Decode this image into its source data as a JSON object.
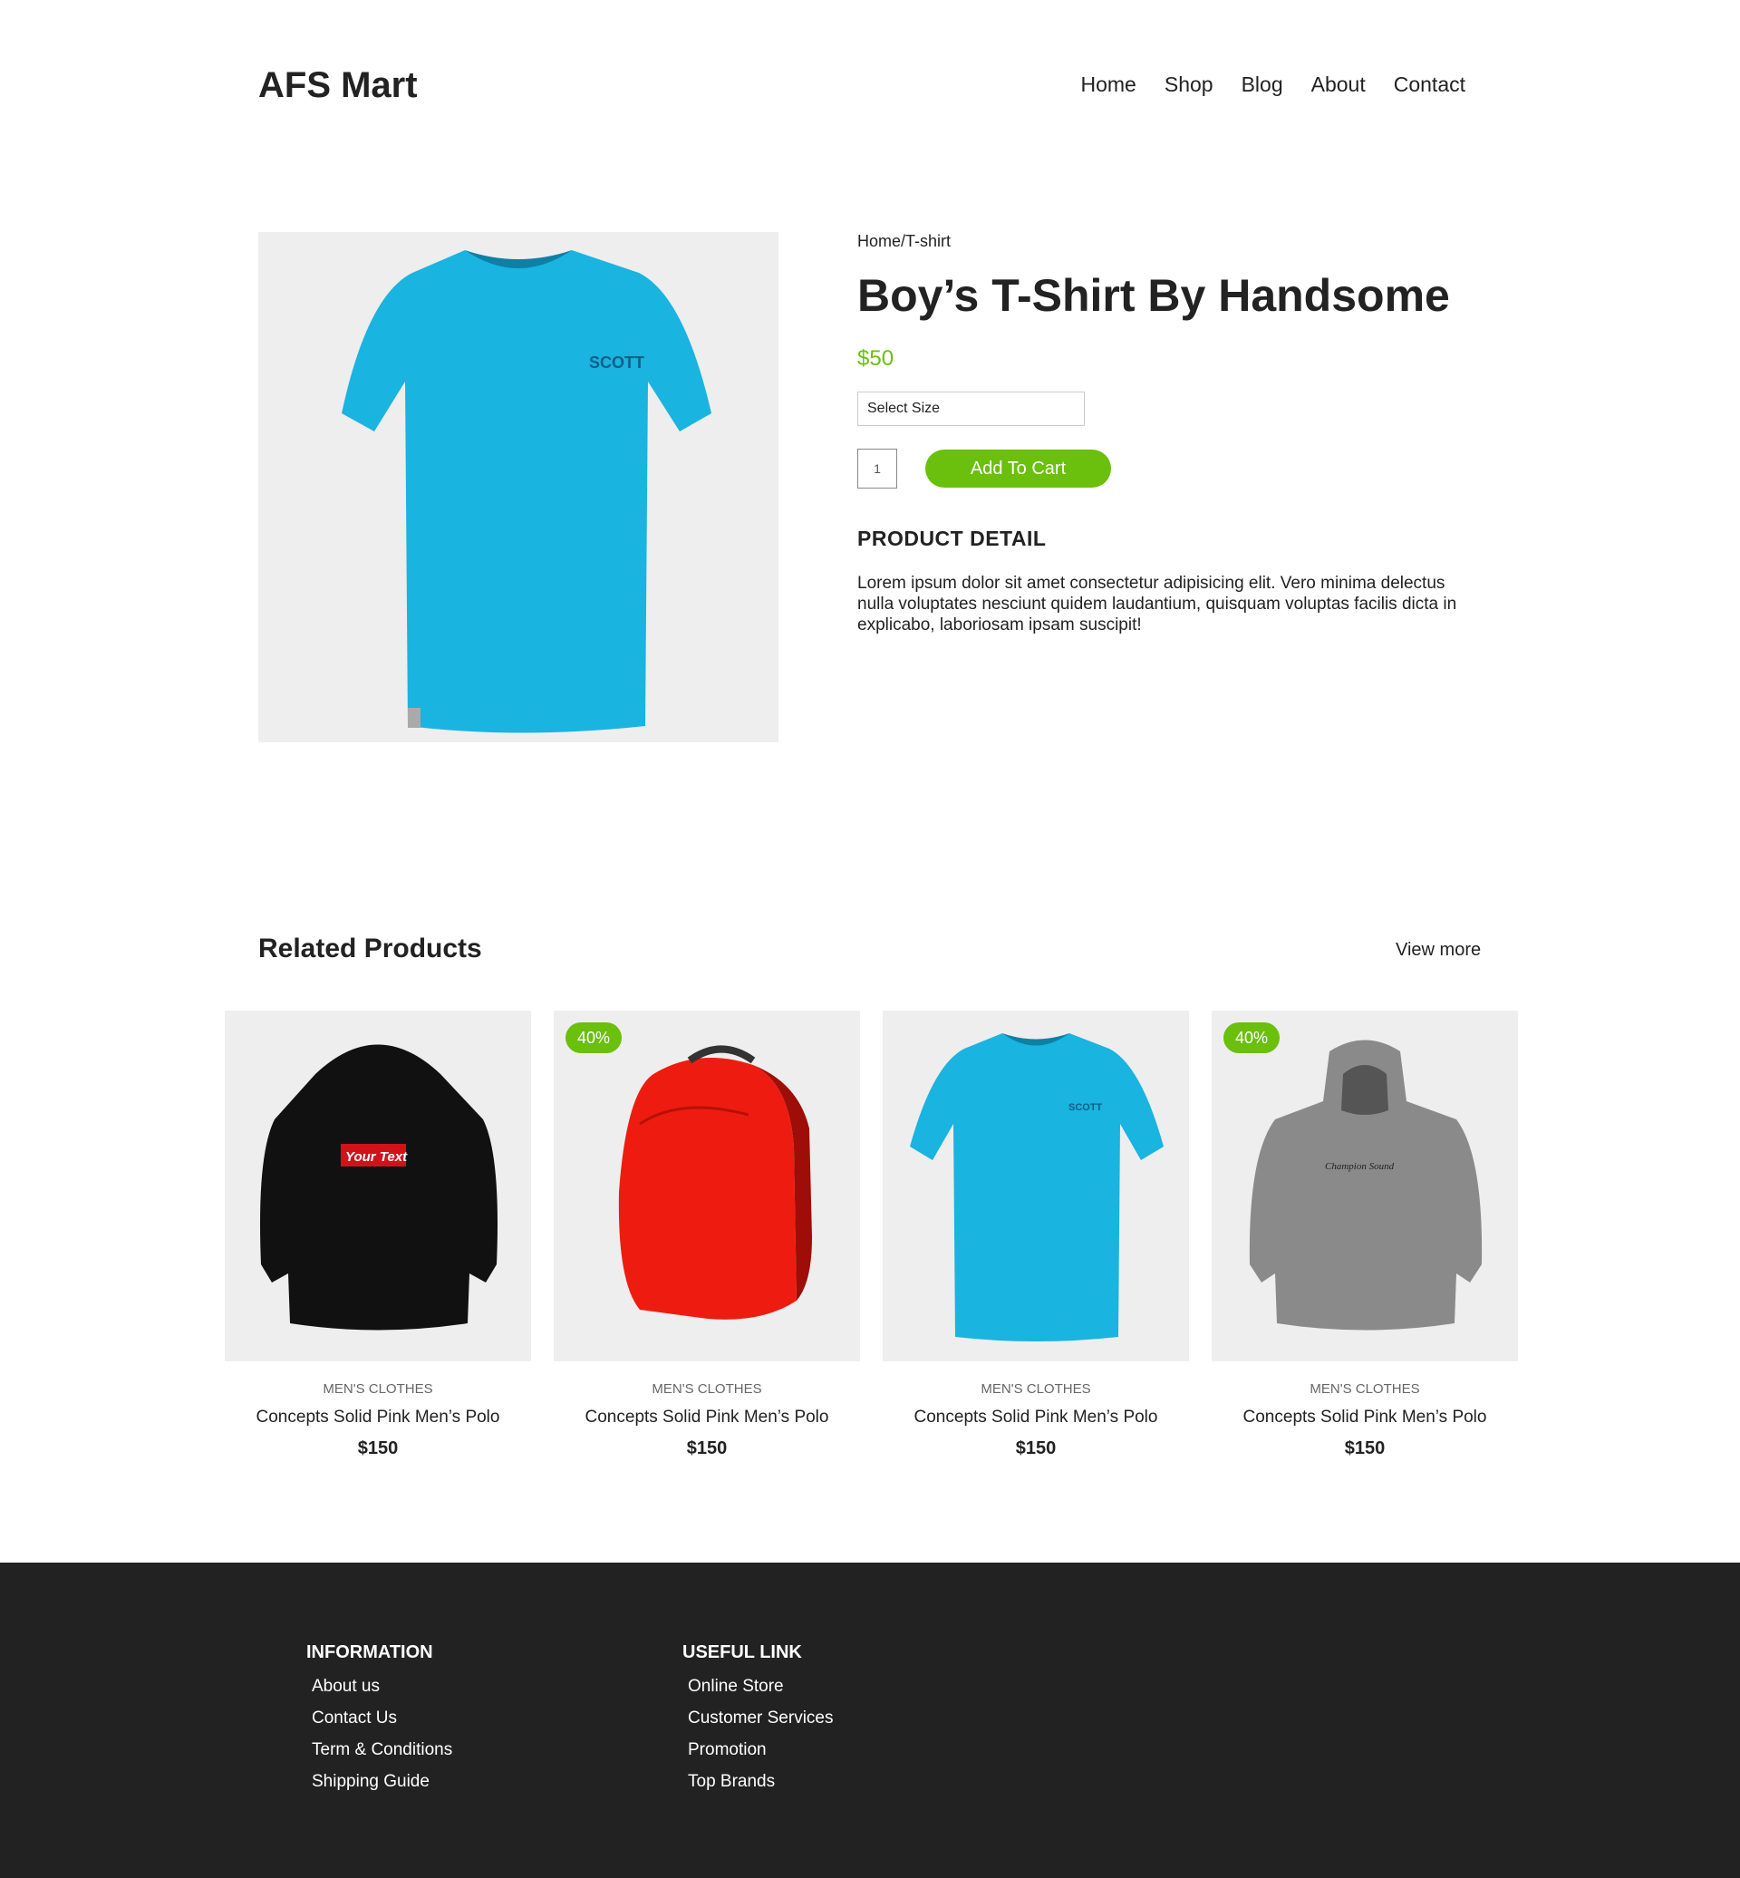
{
  "header": {
    "logo": "AFS Mart",
    "nav": [
      "Home",
      "Shop",
      "Blog",
      "About",
      "Contact"
    ]
  },
  "product": {
    "breadcrumb": "Home/T-shirt",
    "title": "Boy’s T-Shirt By Handsome",
    "price": "$50",
    "size_select": "Select Size",
    "quantity": "1",
    "add_to_cart": "Add To Cart",
    "detail_heading": "PRODUCT DETAIL",
    "detail_text": "Lorem ipsum dolor sit amet consectetur adipisicing elit. Vero minima delectus nulla voluptates nesciunt quidem laudantium, quisquam voluptas facilis dicta in explicabo, laboriosam ipsam suscipit!",
    "tshirt_print": "SCOTT"
  },
  "related": {
    "heading": "Related Products",
    "view_more": "View more",
    "items": [
      {
        "category": "MEN'S CLOTHES",
        "name": "Concepts Solid Pink Men’s Polo",
        "price": "$150",
        "badge": "",
        "image": "black-hoodie",
        "print": "Your Text"
      },
      {
        "category": "MEN'S CLOTHES",
        "name": "Concepts Solid Pink Men’s Polo",
        "price": "$150",
        "badge": "40%",
        "image": "red-backpack",
        "print": ""
      },
      {
        "category": "MEN'S CLOTHES",
        "name": "Concepts Solid Pink Men’s Polo",
        "price": "$150",
        "badge": "",
        "image": "blue-tshirt",
        "print": "SCOTT"
      },
      {
        "category": "MEN'S CLOTHES",
        "name": "Concepts Solid Pink Men’s Polo",
        "price": "$150",
        "badge": "40%",
        "image": "grey-hoodie",
        "print": "Champion Sound"
      }
    ]
  },
  "footer": {
    "information": {
      "heading": "INFORMATION",
      "links": [
        "About us",
        "Contact Us",
        "Term & Conditions",
        "Shipping Guide"
      ]
    },
    "useful": {
      "heading": "USEFUL LINK",
      "links": [
        "Online Store",
        "Customer Services",
        "Promotion",
        "Top Brands"
      ]
    }
  },
  "colors": {
    "accent": "#6bbf0d",
    "footer_bg": "#222222",
    "image_bg": "#eeeeee",
    "tshirt": "#19b4e0",
    "backpack": "#ee1c10",
    "grey_hoodie": "#8a8a8a"
  }
}
